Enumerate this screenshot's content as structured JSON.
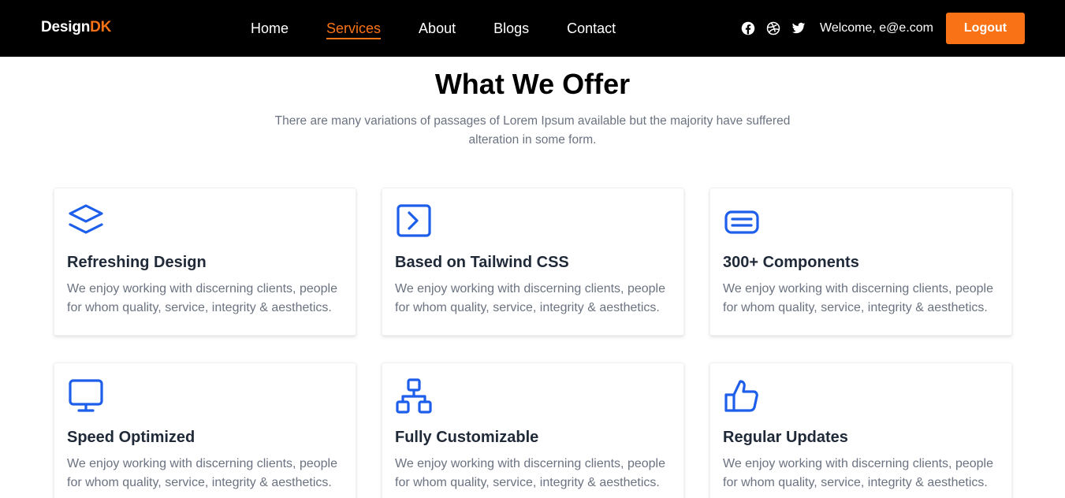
{
  "brand": {
    "name_main": "Design",
    "name_accent": "DK"
  },
  "nav": {
    "links": [
      {
        "label": "Home",
        "active": false
      },
      {
        "label": "Services",
        "active": true
      },
      {
        "label": "About",
        "active": false
      },
      {
        "label": "Blogs",
        "active": false
      },
      {
        "label": "Contact",
        "active": false
      }
    ],
    "social_icons": [
      "facebook-icon",
      "dribbble-icon",
      "twitter-icon"
    ],
    "welcome_text": "Welcome, e@e.com",
    "logout_label": "Logout"
  },
  "section": {
    "title": "What We Offer",
    "subtitle": "There are many variations of passages of Lorem Ipsum available but the majority have suffered alteration in some form."
  },
  "features": [
    {
      "icon": "layers-icon",
      "title": "Refreshing Design",
      "text": "We enjoy working with discerning clients, people for whom quality, service, integrity & aesthetics."
    },
    {
      "icon": "code-icon",
      "title": "Based on Tailwind CSS",
      "text": "We enjoy working with discerning clients, people for whom quality, service, integrity & aesthetics."
    },
    {
      "icon": "components-icon",
      "title": "300+ Components",
      "text": "We enjoy working with discerning clients, people for whom quality, service, integrity & aesthetics."
    },
    {
      "icon": "monitor-icon",
      "title": "Speed Optimized",
      "text": "We enjoy working with discerning clients, people for whom quality, service, integrity & aesthetics."
    },
    {
      "icon": "sitemap-icon",
      "title": "Fully Customizable",
      "text": "We enjoy working with discerning clients, people for whom quality, service, integrity & aesthetics."
    },
    {
      "icon": "thumbs-up-icon",
      "title": "Regular Updates",
      "text": "We enjoy working with discerning clients, people for whom quality, service, integrity & aesthetics."
    }
  ],
  "colors": {
    "accent": "#f97316",
    "icon_blue": "#1d5eea",
    "navbar_bg": "#000000"
  }
}
